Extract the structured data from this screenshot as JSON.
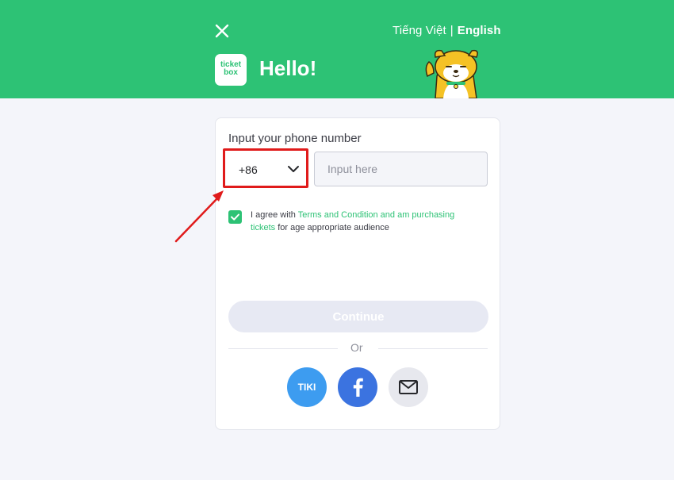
{
  "header": {
    "lang_vi": "Tiếng Việt",
    "lang_sep": "|",
    "lang_en": "English",
    "logo_line1": "ticket",
    "logo_line2": "box",
    "greeting": "Hello!"
  },
  "form": {
    "phone_label": "Input your phone number",
    "country_code": "+86",
    "phone_placeholder": "Input here",
    "phone_value": "",
    "agree_prefix": "I agree with ",
    "agree_link": "Terms and Condition and am purchasing tickets",
    "agree_suffix": " for age appropriate audience",
    "agree_checked": true,
    "continue_label": "Continue",
    "or_label": "Or"
  },
  "social": {
    "tiki_label": "TIKI",
    "icons": [
      "tiki-icon",
      "facebook-icon",
      "email-icon"
    ]
  },
  "colors": {
    "brand_green": "#2dc275",
    "highlight_red": "#e01b1b",
    "tiki_blue": "#3d9cf0",
    "facebook_blue": "#3b73e0"
  }
}
